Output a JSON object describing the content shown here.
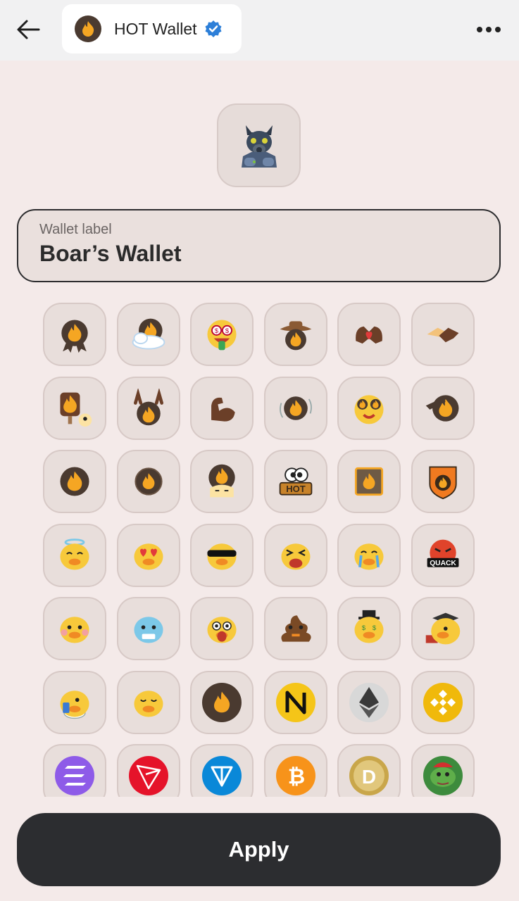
{
  "header": {
    "app_title": "HOT Wallet",
    "back_icon": "arrow-left-icon",
    "verified_icon": "verified-badge-icon",
    "more_icon": "more-horizontal-icon"
  },
  "avatar": {
    "icon": "boar-gasmask-icon"
  },
  "wallet_label": {
    "caption": "Wallet label",
    "value": "Boar’s Wallet"
  },
  "icon_grid": [
    [
      "fire-ribbon-icon",
      "fire-cloud-icon",
      "money-eyes-face-icon",
      "cowboy-fire-icon",
      "heart-hands-icon",
      "handshake-icon"
    ],
    [
      "fire-sign-duck-icon",
      "rock-hands-fire-icon",
      "flexed-biceps-icon",
      "spinning-fire-coin-icon",
      "starstruck-fire-icon",
      "salute-fire-icon"
    ],
    [
      "fire-coin-icon",
      "fire-coin-small-icon",
      "peeking-fire-icon",
      "hot-sign-eyes-icon",
      "fire-square-icon",
      "fire-shield-icon"
    ],
    [
      "angel-duck-icon",
      "heart-eyes-duck-icon",
      "sunglasses-duck-icon",
      "squinting-duck-icon",
      "crying-duck-icon",
      "angry-quack-icon"
    ],
    [
      "blushing-duck-icon",
      "freezing-duck-icon",
      "shocked-duck-icon",
      "poop-duck-icon",
      "rich-duck-icon",
      "graduate-duck-icon"
    ],
    [
      "toilet-duck-icon",
      "praying-duck-icon",
      "hot-coin-icon",
      "near-coin-icon",
      "ethereum-coin-icon",
      "bnb-coin-icon"
    ],
    [
      "solana-coin-icon",
      "tron-coin-icon",
      "ton-coin-icon",
      "bitcoin-coin-icon",
      "dogecoin-coin-icon",
      "pepe-coin-icon"
    ]
  ],
  "quack_text": "QUACK",
  "hot_text": "HOT",
  "apply_label": "Apply",
  "colors": {
    "background": "#f4eae9",
    "button_dark": "#2c2d30",
    "fire_orange": "#f5a623",
    "coin_brown": "#4a3a30",
    "verified_blue": "#2d7fd8"
  }
}
